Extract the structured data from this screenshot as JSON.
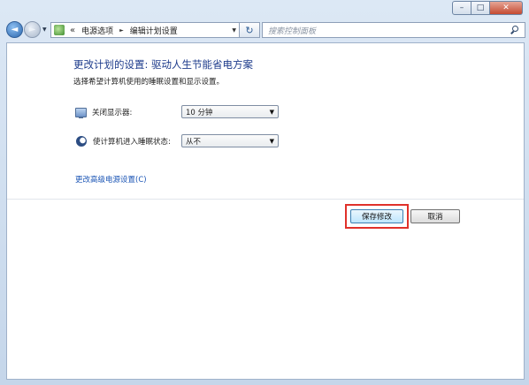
{
  "window": {
    "min_icon": "minimize-icon",
    "max_icon": "maximize-icon",
    "close_icon": "close-icon",
    "min_glyph": "–",
    "max_glyph": "□",
    "close_glyph": "✕"
  },
  "nav": {
    "back_glyph": "◄",
    "fwd_glyph": "►",
    "dropdown_glyph": "▼",
    "address": {
      "overflow_glyph": "«",
      "crumbs": [
        "电源选项",
        "编辑计划设置"
      ],
      "separator_glyph": "►",
      "dropdown_glyph": "▼"
    },
    "refresh_glyph": "↻",
    "search": {
      "placeholder": "搜索控制面板"
    }
  },
  "page": {
    "title": "更改计划的设置: 驱动人生节能省电方案",
    "subtitle": "选择希望计算机使用的睡眠设置和显示设置。",
    "settings": [
      {
        "label": "关闭显示器:",
        "value": "10 分钟",
        "icon": "monitor-icon"
      },
      {
        "label": "使计算机进入睡眠状态:",
        "value": "从不",
        "icon": "moon-icon"
      }
    ],
    "dropdown_arrow": "▼",
    "advanced_link": "更改高级电源设置(C)",
    "save_button": "保存修改",
    "cancel_button": "取消"
  },
  "colors": {
    "title": "#1e3c8c",
    "link": "#1b55b5",
    "highlight": "#e0312a"
  }
}
